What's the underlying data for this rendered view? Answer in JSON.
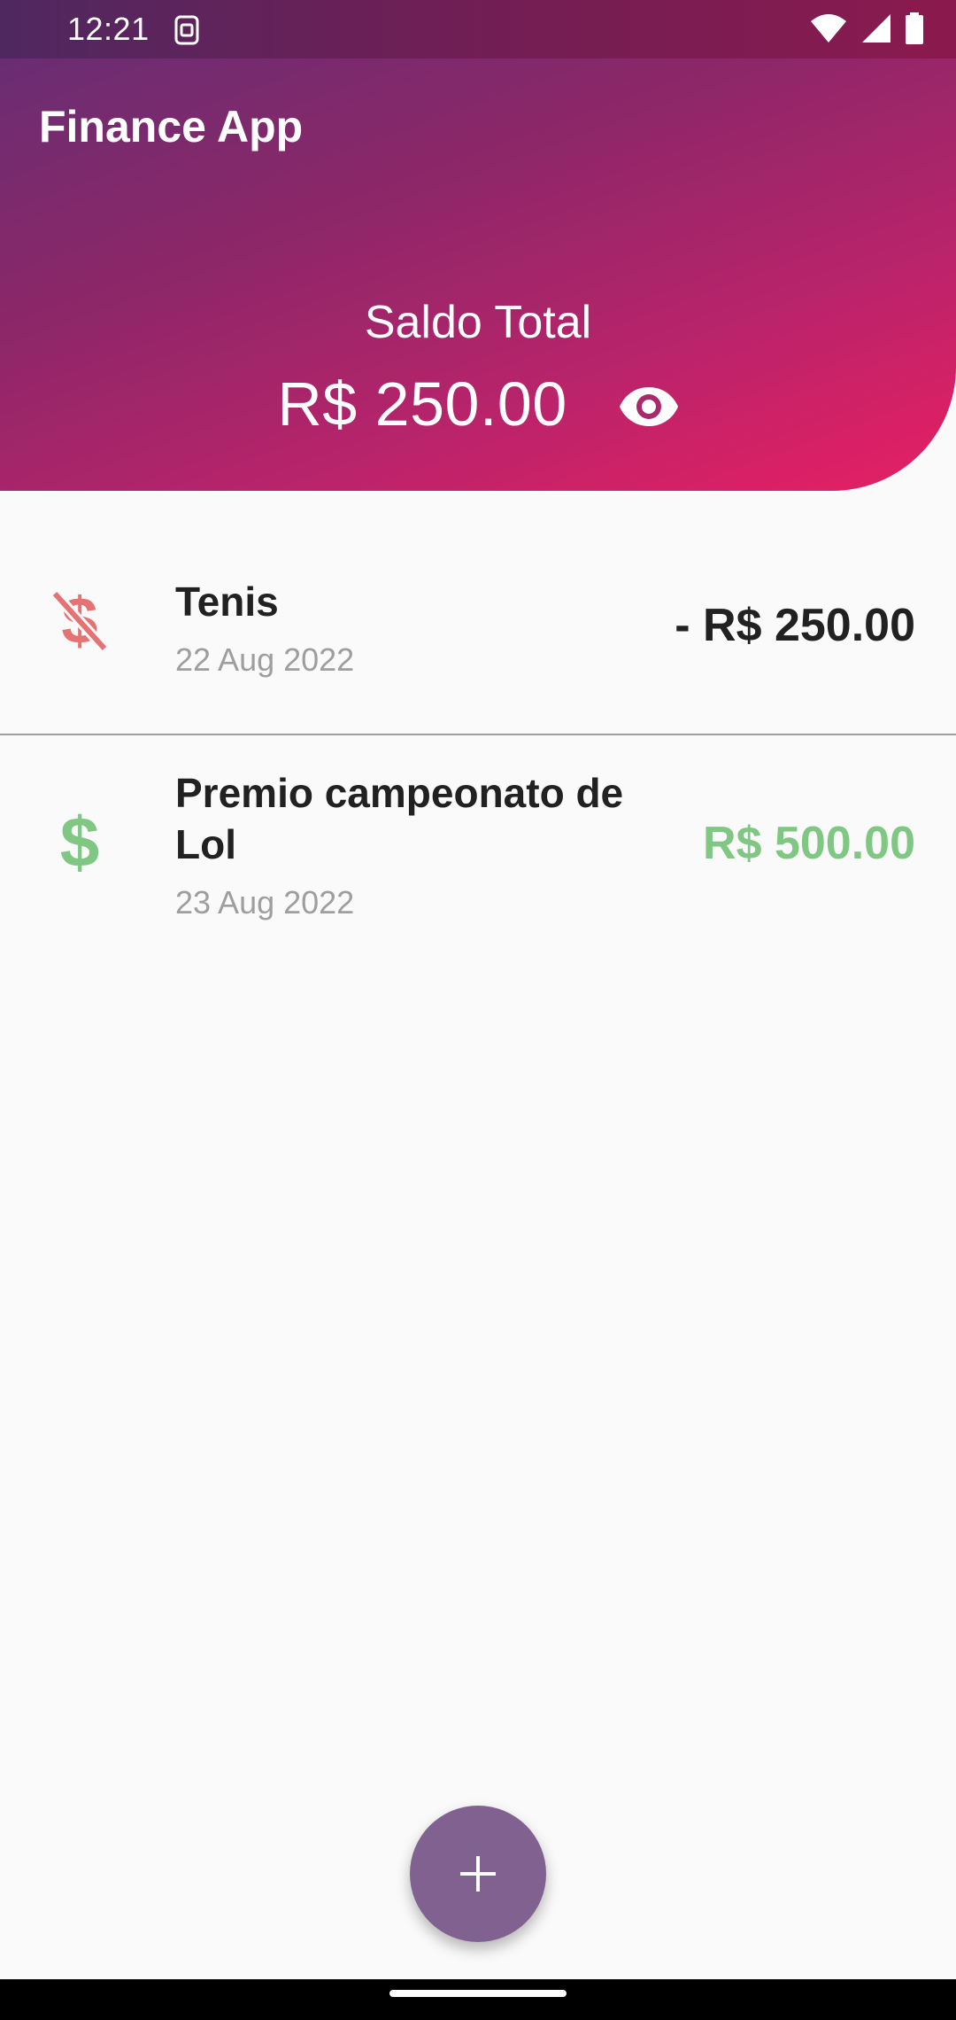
{
  "status_bar": {
    "time": "12:21",
    "icons": [
      "sim-card-icon",
      "wifi-icon",
      "cell-signal-icon",
      "battery-icon"
    ]
  },
  "header": {
    "app_title": "Finance App",
    "balance_label": "Saldo Total",
    "balance_value": "R$ 250.00",
    "visibility_icon": "eye-icon",
    "gradient_colors": [
      "#6a2d72",
      "#e81f63"
    ]
  },
  "transactions": [
    {
      "title": "Tenis",
      "date": "22 Aug 2022",
      "amount": "- R$ 250.00",
      "icon": "money-off-icon",
      "icon_color": "#e57373",
      "amount_color": "#212121"
    },
    {
      "title": "Premio campeonato de Lol",
      "date": "23 Aug 2022",
      "amount": "R$ 500.00",
      "icon": "dollar-icon",
      "icon_color": "#81c784",
      "amount_color": "#81c784"
    }
  ],
  "fab": {
    "icon": "plus-icon",
    "color": "#80618f"
  }
}
